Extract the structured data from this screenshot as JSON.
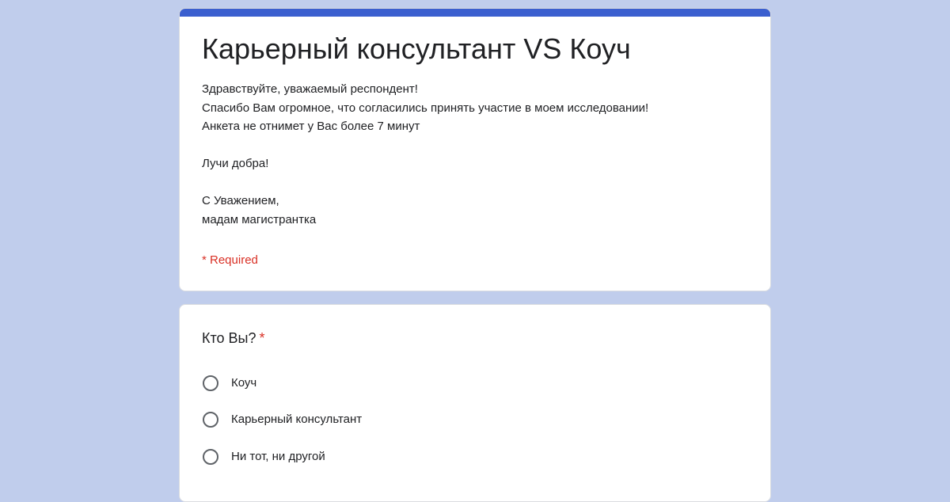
{
  "form": {
    "title": "Карьерный консультант VS Коуч",
    "description_lines": [
      "Здравствуйте, уважаемый респондент!",
      "Спасибо Вам огромное, что согласились принять участие в моем исследовании!",
      "Анкета не отнимет у Вас более 7 минут",
      "",
      "Лучи добра!",
      "",
      "С Уважением,",
      "мадам магистрантка"
    ],
    "required_note": "* Required"
  },
  "question": {
    "title": "Кто Вы?",
    "required_marker": "*",
    "options": [
      {
        "label": "Коуч"
      },
      {
        "label": "Карьерный консультант"
      },
      {
        "label": "Ни тот, ни другой"
      }
    ]
  },
  "colors": {
    "background": "#c0cdec",
    "accent": "#3b5fcf",
    "required": "#d93025"
  }
}
